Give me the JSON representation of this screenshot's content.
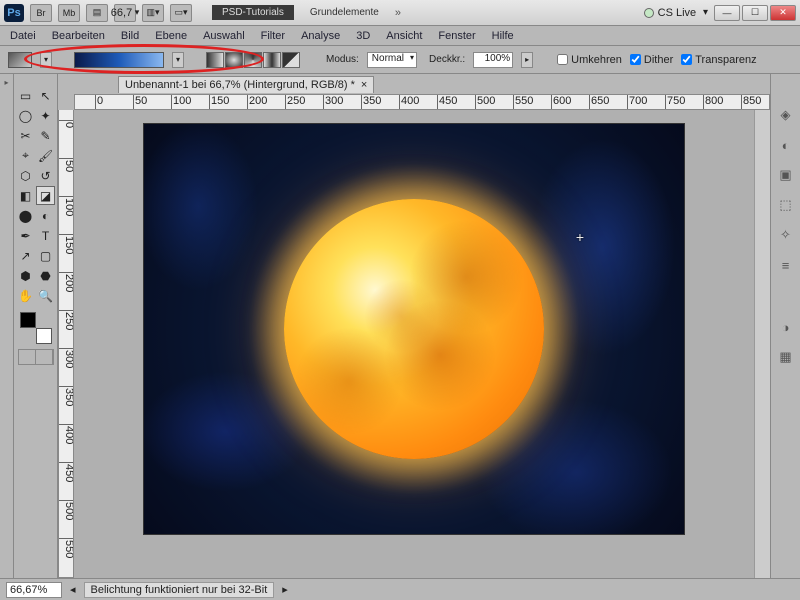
{
  "title": {
    "ps": "Ps",
    "br": "Br",
    "mb": "Mb",
    "zoom": "66,7",
    "tab_a": "PSD-Tutorials",
    "tab_b": "Grundelemente",
    "cslive": "CS Live"
  },
  "menu": [
    "Datei",
    "Bearbeiten",
    "Bild",
    "Ebene",
    "Auswahl",
    "Filter",
    "Analyse",
    "3D",
    "Ansicht",
    "Fenster",
    "Hilfe"
  ],
  "opt": {
    "modus_l": "Modus:",
    "modus_v": "Normal",
    "deck_l": "Deckkr.:",
    "deck_v": "100%",
    "umkehren": "Umkehren",
    "dither": "Dither",
    "transparenz": "Transparenz"
  },
  "doc": {
    "tab": "Unbenannt-1 bei 66,7% (Hintergrund, RGB/8) *",
    "close": "×"
  },
  "status": {
    "zoom": "66,67%",
    "msg": "Belichtung funktioniert nur bei 32-Bit"
  },
  "ruler_h": [
    0,
    50,
    100,
    150,
    200,
    250,
    300,
    350,
    400,
    450,
    500,
    550,
    600,
    650,
    700,
    750,
    800,
    850
  ],
  "ruler_v": [
    0,
    50,
    100,
    150,
    200,
    250,
    300,
    350,
    400,
    450,
    500,
    550
  ]
}
